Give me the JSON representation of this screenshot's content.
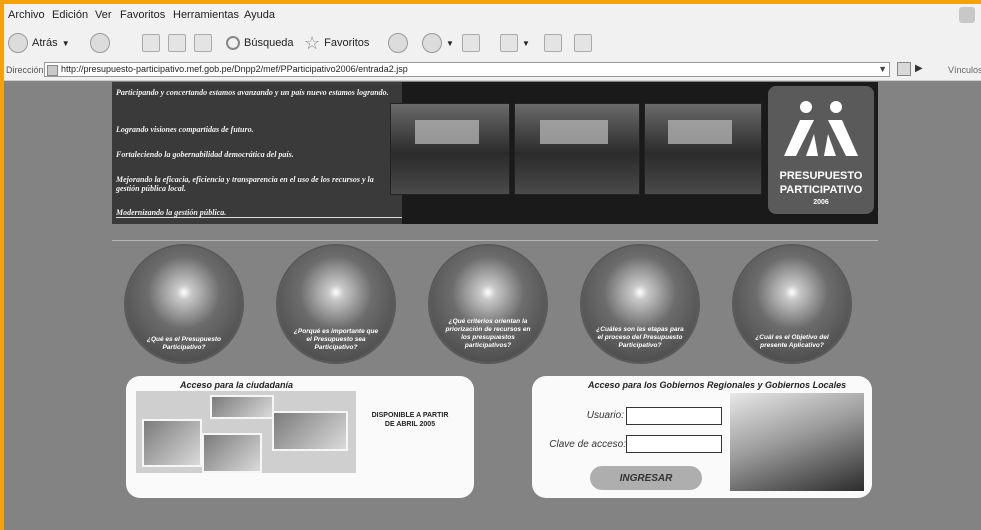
{
  "menu": {
    "items": [
      "Archivo",
      "Edición",
      "Ver",
      "Favoritos",
      "Herramientas",
      "Ayuda"
    ]
  },
  "toolbar": {
    "back_label": "Atrás",
    "search_label": "Búsqueda",
    "favorites_label": "Favoritos"
  },
  "address": {
    "label": "Dirección",
    "url": "http://presupuesto-participativo.mef.gob.pe/Dnpp2/mef/PParticipativo2006/entrada2.jsp",
    "links_label": "Vínculos"
  },
  "banner": {
    "lines": [
      "Participando y concertando estamos avanzando y un país nuevo estamos logrando.",
      "Logrando visiones compartidas de futuro.",
      "Fortaleciendo la gobernabilidad democrática del país.",
      "Mejorando la eficacia, eficiencia y transparencia en el uso de los recursos y la gestión pública local.",
      "Modernizando la gestión pública."
    ],
    "logo_line1": "PRESUPUESTO",
    "logo_line2": "PARTICIPATIVO",
    "logo_year": "2006"
  },
  "bubbles": [
    "¿Qué es el Presupuesto Participativo?",
    "¿Porqué es importante que el Presupuesto sea Participativo?",
    "¿Qué criterios orientan la priorización de recursos en los presupuestos participativos?",
    "¿Cuáles son las etapas para el proceso del Presupuesto Participativo?",
    "¿Cuál es el Objetivo del presente Aplicativo?"
  ],
  "citizen": {
    "title": "Acceso para la ciudadanía",
    "availability": "DISPONIBLE A PARTIR DE ABRIL 2005"
  },
  "gov": {
    "title": "Acceso para los Gobiernos Regionales y Gobiernos Locales",
    "user_label": "Usuario:",
    "user_value": "",
    "key_label": "Clave de acceso:",
    "key_value": "",
    "submit_label": "INGRESAR"
  },
  "colors": {
    "window_border": "#f4a10a",
    "page_bg": "#838383",
    "banner_bg": "#1a1a1a"
  }
}
